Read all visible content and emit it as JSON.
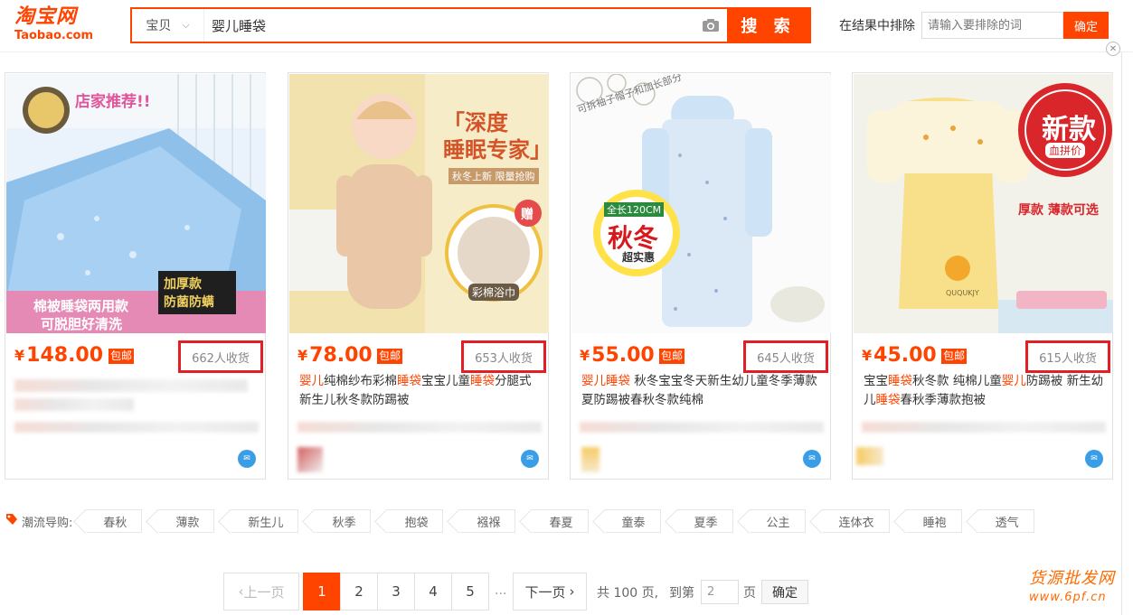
{
  "logo": {
    "cn": "淘宝网",
    "en": "Taobao.com"
  },
  "search": {
    "type": "宝贝",
    "query": "婴儿睡袋",
    "button": "搜 索"
  },
  "exclude": {
    "label": "在结果中排除",
    "placeholder": "请输入要排除的词",
    "button": "确定"
  },
  "close_symbol": "✕",
  "colors": {
    "accent": "#ff4400",
    "highlight_box": "#e31f25",
    "wangwang": "#3a9ee7"
  },
  "products": [
    {
      "price_symbol": "¥",
      "price": "148.00",
      "badge": "包邮",
      "sold": "662人收货",
      "image": {
        "banner": "店家推荐!!",
        "caption1": "棉被睡袋两用款",
        "caption2": "可脱胆好清洗",
        "tag1": "加厚款",
        "tag2": "防菌防螨"
      },
      "title_parts": []
    },
    {
      "price_symbol": "¥",
      "price": "78.00",
      "badge": "包邮",
      "sold": "653人收货",
      "image": {
        "headline1": "「深度",
        "headline2": "睡眠专家」",
        "sub": "秋冬上新 限量抢购",
        "gift": "赠",
        "gift_label": "彩棉浴巾"
      },
      "title_parts": [
        {
          "text": "婴儿",
          "hl": true
        },
        {
          "text": "纯棉纱布彩棉",
          "hl": false
        },
        {
          "text": "睡袋",
          "hl": true
        },
        {
          "text": "宝宝儿童",
          "hl": false
        },
        {
          "text": "睡袋",
          "hl": true
        },
        {
          "text": "分腿式新生儿秋冬款防踢被",
          "hl": false
        }
      ]
    },
    {
      "price_symbol": "¥",
      "price": "55.00",
      "badge": "包邮",
      "sold": "645人收货",
      "image": {
        "note": "可拆袖子帽子和加长部分",
        "length": "全长120CM",
        "season": "秋冬",
        "value": "超实惠"
      },
      "title_parts": [
        {
          "text": "婴儿睡袋",
          "hl": true
        },
        {
          "text": " 秋冬宝宝冬天新生幼儿童冬季薄款夏防踢被春秋冬款纯棉",
          "hl": false
        }
      ]
    },
    {
      "price_symbol": "¥",
      "price": "45.00",
      "badge": "包邮",
      "sold": "615人收货",
      "image": {
        "circle1": "新款",
        "circle2": "血拼价",
        "side": "厚款 薄款可选",
        "brand": "QUQUKJY"
      },
      "title_parts": [
        {
          "text": "宝宝",
          "hl": false
        },
        {
          "text": "睡袋",
          "hl": true
        },
        {
          "text": "秋冬款 纯棉儿童",
          "hl": false
        },
        {
          "text": "婴儿",
          "hl": true
        },
        {
          "text": "防踢被 新生幼儿",
          "hl": false
        },
        {
          "text": "睡袋",
          "hl": true
        },
        {
          "text": "春秋季薄款抱被",
          "hl": false
        }
      ]
    }
  ],
  "trends": {
    "label": "潮流导购:",
    "tags": [
      "春秋",
      "薄款",
      "新生儿",
      "秋季",
      "抱袋",
      "襁褓",
      "春夏",
      "童泰",
      "夏季",
      "公主",
      "连体衣",
      "睡袍",
      "透气"
    ]
  },
  "pagination": {
    "prev": "上一页",
    "pages": [
      "1",
      "2",
      "3",
      "4",
      "5"
    ],
    "current": "1",
    "ellipsis": "...",
    "next": "下一页",
    "total": "共 100 页,",
    "goto": "到第",
    "goto_value": "2",
    "unit": "页",
    "confirm": "确定"
  },
  "watermark": {
    "line1": "货源批发网",
    "line2": "www.6pf.cn"
  }
}
